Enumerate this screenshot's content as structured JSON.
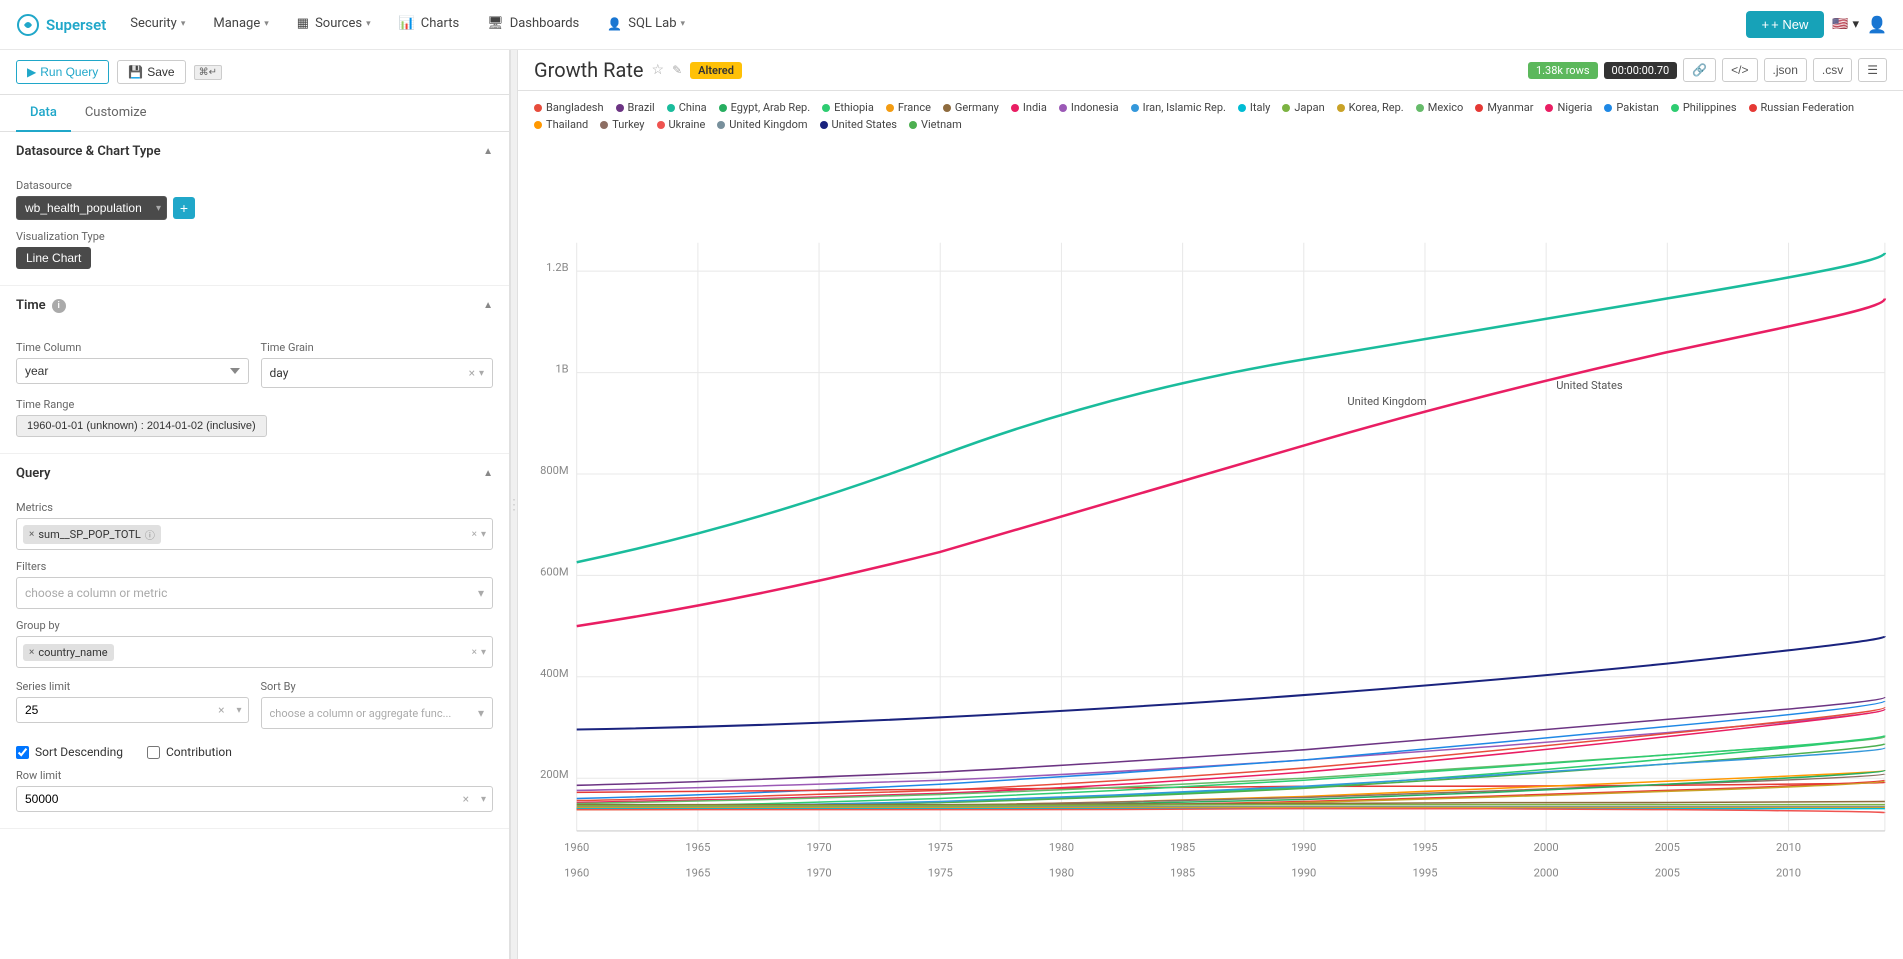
{
  "navbar": {
    "brand": "Superset",
    "items": [
      {
        "label": "Security",
        "has_dropdown": true
      },
      {
        "label": "Manage",
        "has_dropdown": true
      },
      {
        "label": "Sources",
        "has_dropdown": true
      },
      {
        "label": "Charts",
        "has_dropdown": false
      },
      {
        "label": "Dashboards",
        "has_dropdown": false
      },
      {
        "label": "SQL Lab",
        "has_dropdown": true
      }
    ],
    "new_button": "+ New",
    "flag": "🇺🇸",
    "user_icon": "👤"
  },
  "left_panel": {
    "toolbar": {
      "run_query": "▶ Run Query",
      "save": "💾 Save",
      "shortcut": "⌘↵"
    },
    "tabs": [
      "Data",
      "Customize"
    ],
    "active_tab": "Data",
    "sections": {
      "datasource": {
        "title": "Datasource & Chart Type",
        "datasource_label": "Datasource",
        "datasource_value": "wb_health_population",
        "viz_type_label": "Visualization Type",
        "viz_type_value": "Line Chart"
      },
      "time": {
        "title": "Time",
        "time_column_label": "Time Column",
        "time_column_value": "year",
        "time_grain_label": "Time Grain",
        "time_grain_value": "day",
        "time_range_label": "Time Range",
        "time_range_value": "1960-01-01 (unknown) : 2014-01-02 (inclusive)"
      },
      "query": {
        "title": "Query",
        "metrics_label": "Metrics",
        "metrics_value": "sum__SP_POP_TOTL",
        "filters_label": "Filters",
        "filters_placeholder": "choose a column or metric",
        "group_by_label": "Group by",
        "group_by_value": "country_name",
        "series_limit_label": "Series limit",
        "series_limit_value": "25",
        "sort_by_label": "Sort By",
        "sort_by_placeholder": "choose a column or aggregate func...",
        "sort_descending_label": "Sort Descending",
        "sort_descending_checked": true,
        "contribution_label": "Contribution",
        "contribution_checked": false,
        "row_limit_label": "Row limit",
        "row_limit_value": "50000"
      }
    }
  },
  "chart": {
    "title": "Growth Rate",
    "badge_altered": "Altered",
    "rows_badge": "1.38k rows",
    "time_badge": "00:00:00.70",
    "legend": [
      {
        "label": "Bangladesh",
        "color": "#e74c3c"
      },
      {
        "label": "Brazil",
        "color": "#6c3483"
      },
      {
        "label": "China",
        "color": "#1abc9c"
      },
      {
        "label": "Egypt, Arab Rep.",
        "color": "#27ae60"
      },
      {
        "label": "Ethiopia",
        "color": "#2ecc71"
      },
      {
        "label": "France",
        "color": "#f39c12"
      },
      {
        "label": "Germany",
        "color": "#8e6b3e"
      },
      {
        "label": "India",
        "color": "#e91e63"
      },
      {
        "label": "Indonesia",
        "color": "#9b59b6"
      },
      {
        "label": "Iran, Islamic Rep.",
        "color": "#3498db"
      },
      {
        "label": "Italy",
        "color": "#00bcd4"
      },
      {
        "label": "Japan",
        "color": "#7cb342"
      },
      {
        "label": "Korea, Rep.",
        "color": "#c9a227"
      },
      {
        "label": "Mexico",
        "color": "#66bb6a"
      },
      {
        "label": "Myanmar",
        "color": "#e53935"
      },
      {
        "label": "Nigeria",
        "color": "#e91e63"
      },
      {
        "label": "Pakistan",
        "color": "#1e88e5"
      },
      {
        "label": "Philippines",
        "color": "#2ecc71"
      },
      {
        "label": "Russian Federation",
        "color": "#e53935"
      },
      {
        "label": "Thailand",
        "color": "#ff9800"
      },
      {
        "label": "Turkey",
        "color": "#8d6e63"
      },
      {
        "label": "Ukraine",
        "color": "#ef5350"
      },
      {
        "label": "United Kingdom",
        "color": "#78909c"
      },
      {
        "label": "United States",
        "color": "#1a237e"
      },
      {
        "label": "Vietnam",
        "color": "#4caf50"
      }
    ],
    "toolbar_icons": [
      "link",
      "code",
      "json",
      "csv",
      "menu"
    ]
  }
}
